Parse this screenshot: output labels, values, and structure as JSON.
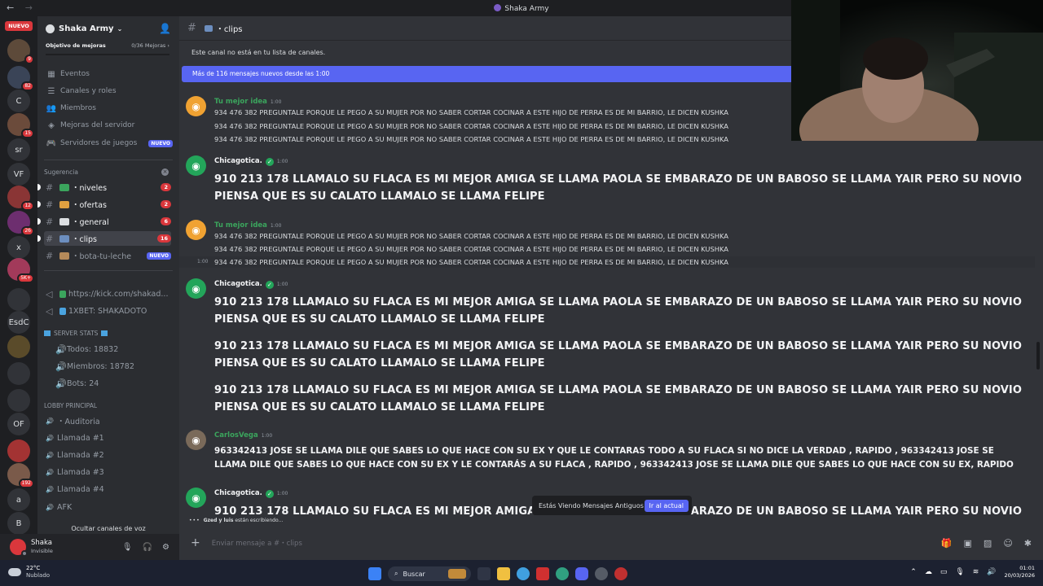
{
  "window": {
    "title": "Shaka Army",
    "back": "←",
    "forward": "→"
  },
  "rail": {
    "nuevo": "NUEVO",
    "servers": [
      {
        "label": "",
        "badge": "9",
        "color": "#5d4a3a"
      },
      {
        "label": "",
        "badge": "82",
        "color": "#3a4457"
      },
      {
        "label": "C",
        "badge": "",
        "color": "#313338"
      },
      {
        "label": "",
        "badge": "15",
        "color": "#6b4b3b"
      },
      {
        "label": "sr",
        "badge": "",
        "color": "#313338"
      },
      {
        "label": "VF",
        "badge": "",
        "color": "#313338"
      },
      {
        "label": "",
        "badge": "12",
        "color": "#8a3535"
      },
      {
        "label": "",
        "badge": "26",
        "color": "#6d2e6f"
      },
      {
        "label": "x",
        "badge": "",
        "color": "#313338"
      },
      {
        "label": "",
        "badge": "5K+",
        "color": "#a23a5a"
      },
      {
        "label": "",
        "badge": "",
        "color": "#313338"
      },
      {
        "label": "EsdC",
        "badge": "",
        "color": "#313338"
      },
      {
        "label": "",
        "badge": "",
        "color": "#5a4b2a"
      },
      {
        "label": "",
        "badge": "",
        "color": "#313338"
      },
      {
        "label": "",
        "badge": "",
        "color": "#313338"
      },
      {
        "label": "OF",
        "badge": "",
        "color": "#313338"
      },
      {
        "label": "",
        "badge": "",
        "color": "#a33333"
      },
      {
        "label": "",
        "badge": "192",
        "color": "#7a5a4a"
      },
      {
        "label": "a",
        "badge": "",
        "color": "#313338"
      },
      {
        "label": "B",
        "badge": "",
        "color": "#313338"
      }
    ]
  },
  "sidebar": {
    "server_name": "Shaka Army",
    "goal_label": "Objetivo de mejoras",
    "goal_count": "0/36 Mejoras",
    "items": [
      {
        "label": "Eventos",
        "icon": "calendar-icon"
      },
      {
        "label": "Canales y roles",
        "icon": "list-icon"
      },
      {
        "label": "Miembros",
        "icon": "members-icon"
      },
      {
        "label": "Mejoras del servidor",
        "icon": "boost-icon"
      },
      {
        "label": "Servidores de juegos",
        "icon": "gamepad-icon",
        "tag": "NUEVO"
      }
    ],
    "suggest_label": "Sugerencia",
    "channels": [
      {
        "name": "・niveles",
        "badge": "2",
        "color": "#3ba55d"
      },
      {
        "name": "・ofertas",
        "badge": "2",
        "color": "#e0a040"
      },
      {
        "name": "・general",
        "badge": "6",
        "color": "#dbdee1"
      },
      {
        "name": "・clips",
        "badge": "16",
        "color": "#6c8ebf"
      },
      {
        "name": "・bota-tu-leche",
        "tag": "NUEVO",
        "color": "#b58a5a"
      }
    ],
    "links": [
      "https://kick.com/shakad...",
      "1XBET: SHAKADOTO"
    ],
    "stats_header": "SERVER STATS",
    "stats": [
      "Todos: 18832",
      "Miembros: 18782",
      "Bots: 24"
    ],
    "lobby_header": "LOBBY PRINCIPAL",
    "voice": [
      "・Auditoria",
      "Llamada #1",
      "Llamada #2",
      "Llamada #3",
      "Llamada #4",
      "AFK"
    ],
    "hide_voice": "Ocultar canales de voz"
  },
  "user": {
    "name": "Shaka",
    "status": "Invisible"
  },
  "channel": {
    "name": "・clips",
    "notice": "Este canal no está en tu lista de canales.",
    "new_messages": "Más de 116 mensajes nuevos desde las 1:00"
  },
  "messages": [
    {
      "author": "Tu mejor idea",
      "time": "1:00",
      "color": "#3ba55d",
      "line": "934 476 382 PREGUNTALE PORQUE LE PEGO A SU MUJER POR NO SABER CORTAR COCINAR A ESTE HIJO DE PERRA ES DE MI BARRIO, LE DICEN KUSHKA"
    },
    {
      "author": "Chicagotica.",
      "time": "1:00",
      "color": "#f2f3f5",
      "line1": "910 213 178 LLAMALO SU FLACA ES MI MEJOR AMIGA SE LLAMA PAOLA SE EMBARAZO DE UN BABOSO SE LLAMA YAIR PERO SU NOVIO",
      "line2": "PIENSA QUE ES SU CALATO LLAMALO  SE LLAMA FELIPE"
    },
    {
      "author": "CarlosVega",
      "time": "1:00",
      "color": "#3ba55d",
      "line1": "963342413 JOSE SE LLAMA DILE QUE SABES LO QUE HACE CON SU EX Y QUE LE CONTARAS TODO A SU FLACA SI NO DICE LA VERDAD , RAPIDO   , 963342413 JOSE SE",
      "line2": "LLAMA DILE QUE SABES LO QUE HACE CON SU EX Y LE CONTARÁS A SU FLACA , RAPIDO   , 963342413 JOSE SE LLAMA DILE QUE SABES LO QUE HACE CON SU EX, RAPIDO"
    }
  ],
  "side_time": "1:00",
  "typing": {
    "names": "Gzed y luis",
    "suffix": " están escribiendo..."
  },
  "old_messages": {
    "label": "Estás Viendo Mensajes Antiguos",
    "button": "Ir al actual"
  },
  "composer": {
    "placeholder": "Enviar mensaje a #・clips"
  },
  "taskbar": {
    "temp": "22°C",
    "condition": "Nublado",
    "search": "Buscar",
    "time": "01:01",
    "date": "20/03/2026"
  }
}
